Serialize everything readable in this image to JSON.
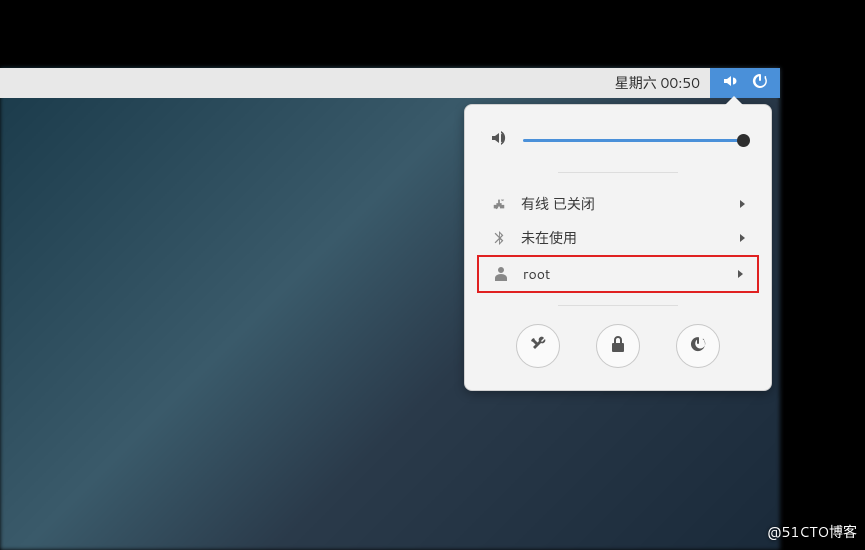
{
  "topbar": {
    "clock": "星期六 00:50"
  },
  "system_menu": {
    "network": {
      "label": "有线 已关闭"
    },
    "bluetooth": {
      "label": "未在使用"
    },
    "user": {
      "label": "root"
    }
  },
  "watermark": "@51CTO博客"
}
